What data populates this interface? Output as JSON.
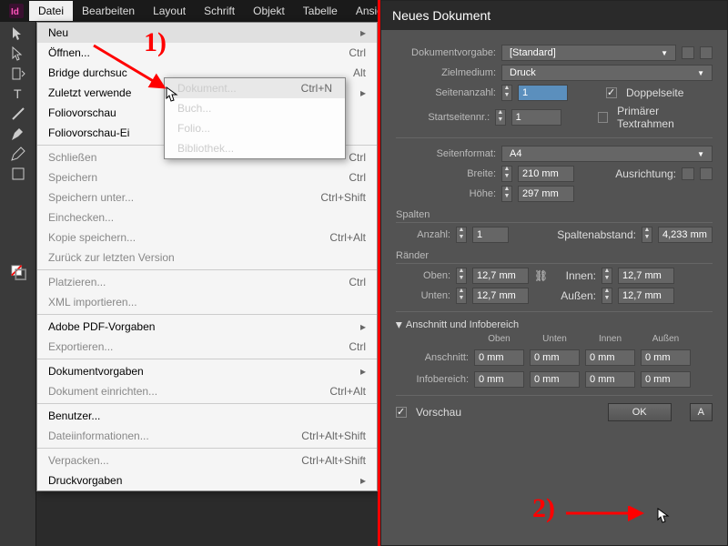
{
  "menubar": [
    "Datei",
    "Bearbeiten",
    "Layout",
    "Schrift",
    "Objekt",
    "Tabelle",
    "Ansich"
  ],
  "dropdown": {
    "groups": [
      [
        {
          "label": "Neu",
          "hint": "",
          "hi": true,
          "sub": true
        },
        {
          "label": "Öffnen...",
          "hint": "Ctrl"
        },
        {
          "label": "Bridge durchsuc",
          "hint": "Alt"
        },
        {
          "label": "Zuletzt verwende",
          "hint": "",
          "sub": true
        },
        {
          "label": "Foliovorschau"
        },
        {
          "label": "Foliovorschau-Ei"
        }
      ],
      [
        {
          "label": "Schließen",
          "hint": "Ctrl",
          "dis": true
        },
        {
          "label": "Speichern",
          "hint": "Ctrl",
          "dis": true
        },
        {
          "label": "Speichern unter...",
          "hint": "Ctrl+Shift",
          "dis": true
        },
        {
          "label": "Einchecken...",
          "dis": true
        },
        {
          "label": "Kopie speichern...",
          "hint": "Ctrl+Alt",
          "dis": true
        },
        {
          "label": "Zurück zur letzten Version",
          "dis": true
        }
      ],
      [
        {
          "label": "Platzieren...",
          "hint": "Ctrl",
          "dis": true
        },
        {
          "label": "XML importieren...",
          "dis": true
        }
      ],
      [
        {
          "label": "Adobe PDF-Vorgaben",
          "sub": true
        },
        {
          "label": "Exportieren...",
          "hint": "Ctrl",
          "dis": true
        }
      ],
      [
        {
          "label": "Dokumentvorgaben",
          "sub": true
        },
        {
          "label": "Dokument einrichten...",
          "hint": "Ctrl+Alt",
          "dis": true
        }
      ],
      [
        {
          "label": "Benutzer..."
        },
        {
          "label": "Dateiinformationen...",
          "hint": "Ctrl+Alt+Shift",
          "dis": true
        }
      ],
      [
        {
          "label": "Verpacken...",
          "hint": "Ctrl+Alt+Shift",
          "dis": true
        },
        {
          "label": "Druckvorgaben",
          "sub": true
        }
      ]
    ]
  },
  "submenu": [
    {
      "label": "Dokument...",
      "hint": "Ctrl+N",
      "hi": true
    },
    {
      "label": "Buch..."
    },
    {
      "label": "Folio..."
    },
    {
      "label": "Bibliothek..."
    }
  ],
  "annot": {
    "one": "1)",
    "two": "2)"
  },
  "dialog": {
    "title": "Neues Dokument",
    "preset_label": "Dokumentvorgabe:",
    "preset_value": "[Standard]",
    "intent_label": "Zielmedium:",
    "intent_value": "Druck",
    "pages_label": "Seitenanzahl:",
    "pages_value": "1",
    "facing_label": "Doppelseite",
    "facing_on": true,
    "start_label": "Startseitennr.:",
    "start_value": "1",
    "ptf_label": "Primärer Textrahmen",
    "ptf_on": false,
    "format_label": "Seitenformat:",
    "format_value": "A4",
    "width_label": "Breite:",
    "width_value": "210 mm",
    "height_label": "Höhe:",
    "height_value": "297 mm",
    "orient_label": "Ausrichtung:",
    "columns_title": "Spalten",
    "colcount_label": "Anzahl:",
    "colcount_value": "1",
    "gutter_label": "Spaltenabstand:",
    "gutter_value": "4,233 mm",
    "margins_title": "Ränder",
    "top_label": "Oben:",
    "top_value": "12,7 mm",
    "bottom_label": "Unten:",
    "bottom_value": "12,7 mm",
    "inside_label": "Innen:",
    "inside_value": "12,7 mm",
    "outside_label": "Außen:",
    "outside_value": "12,7 mm",
    "bleed_title": "Anschnitt und Infobereich",
    "col_top": "Oben",
    "col_bot": "Unten",
    "col_in": "Innen",
    "col_out": "Außen",
    "bleed_label": "Anschnitt:",
    "bleed_value": "0 mm",
    "slug_label": "Infobereich:",
    "slug_value": "0 mm",
    "preview_label": "Vorschau",
    "preview_on": true,
    "ok": "OK",
    "cancel": "A"
  }
}
